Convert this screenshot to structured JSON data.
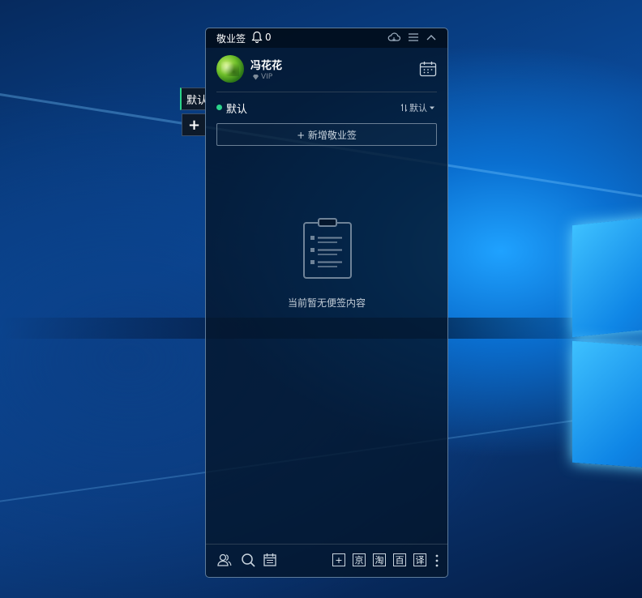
{
  "app": {
    "title": "敬业签",
    "notification_count": "0"
  },
  "side_tabs": {
    "active_label": "默认",
    "add_label": "+"
  },
  "user": {
    "name": "冯花花",
    "badge": "VIP"
  },
  "group": {
    "name": "默认",
    "sort_label": "默认"
  },
  "add_note_label": "+ 新增敬业签",
  "empty_message": "当前暂无便签内容",
  "bottom_shortcuts": [
    "+",
    "京",
    "淘",
    "百",
    "译"
  ],
  "colors": {
    "accent_green": "#2bd48a",
    "panel_bg": "#04162c"
  }
}
